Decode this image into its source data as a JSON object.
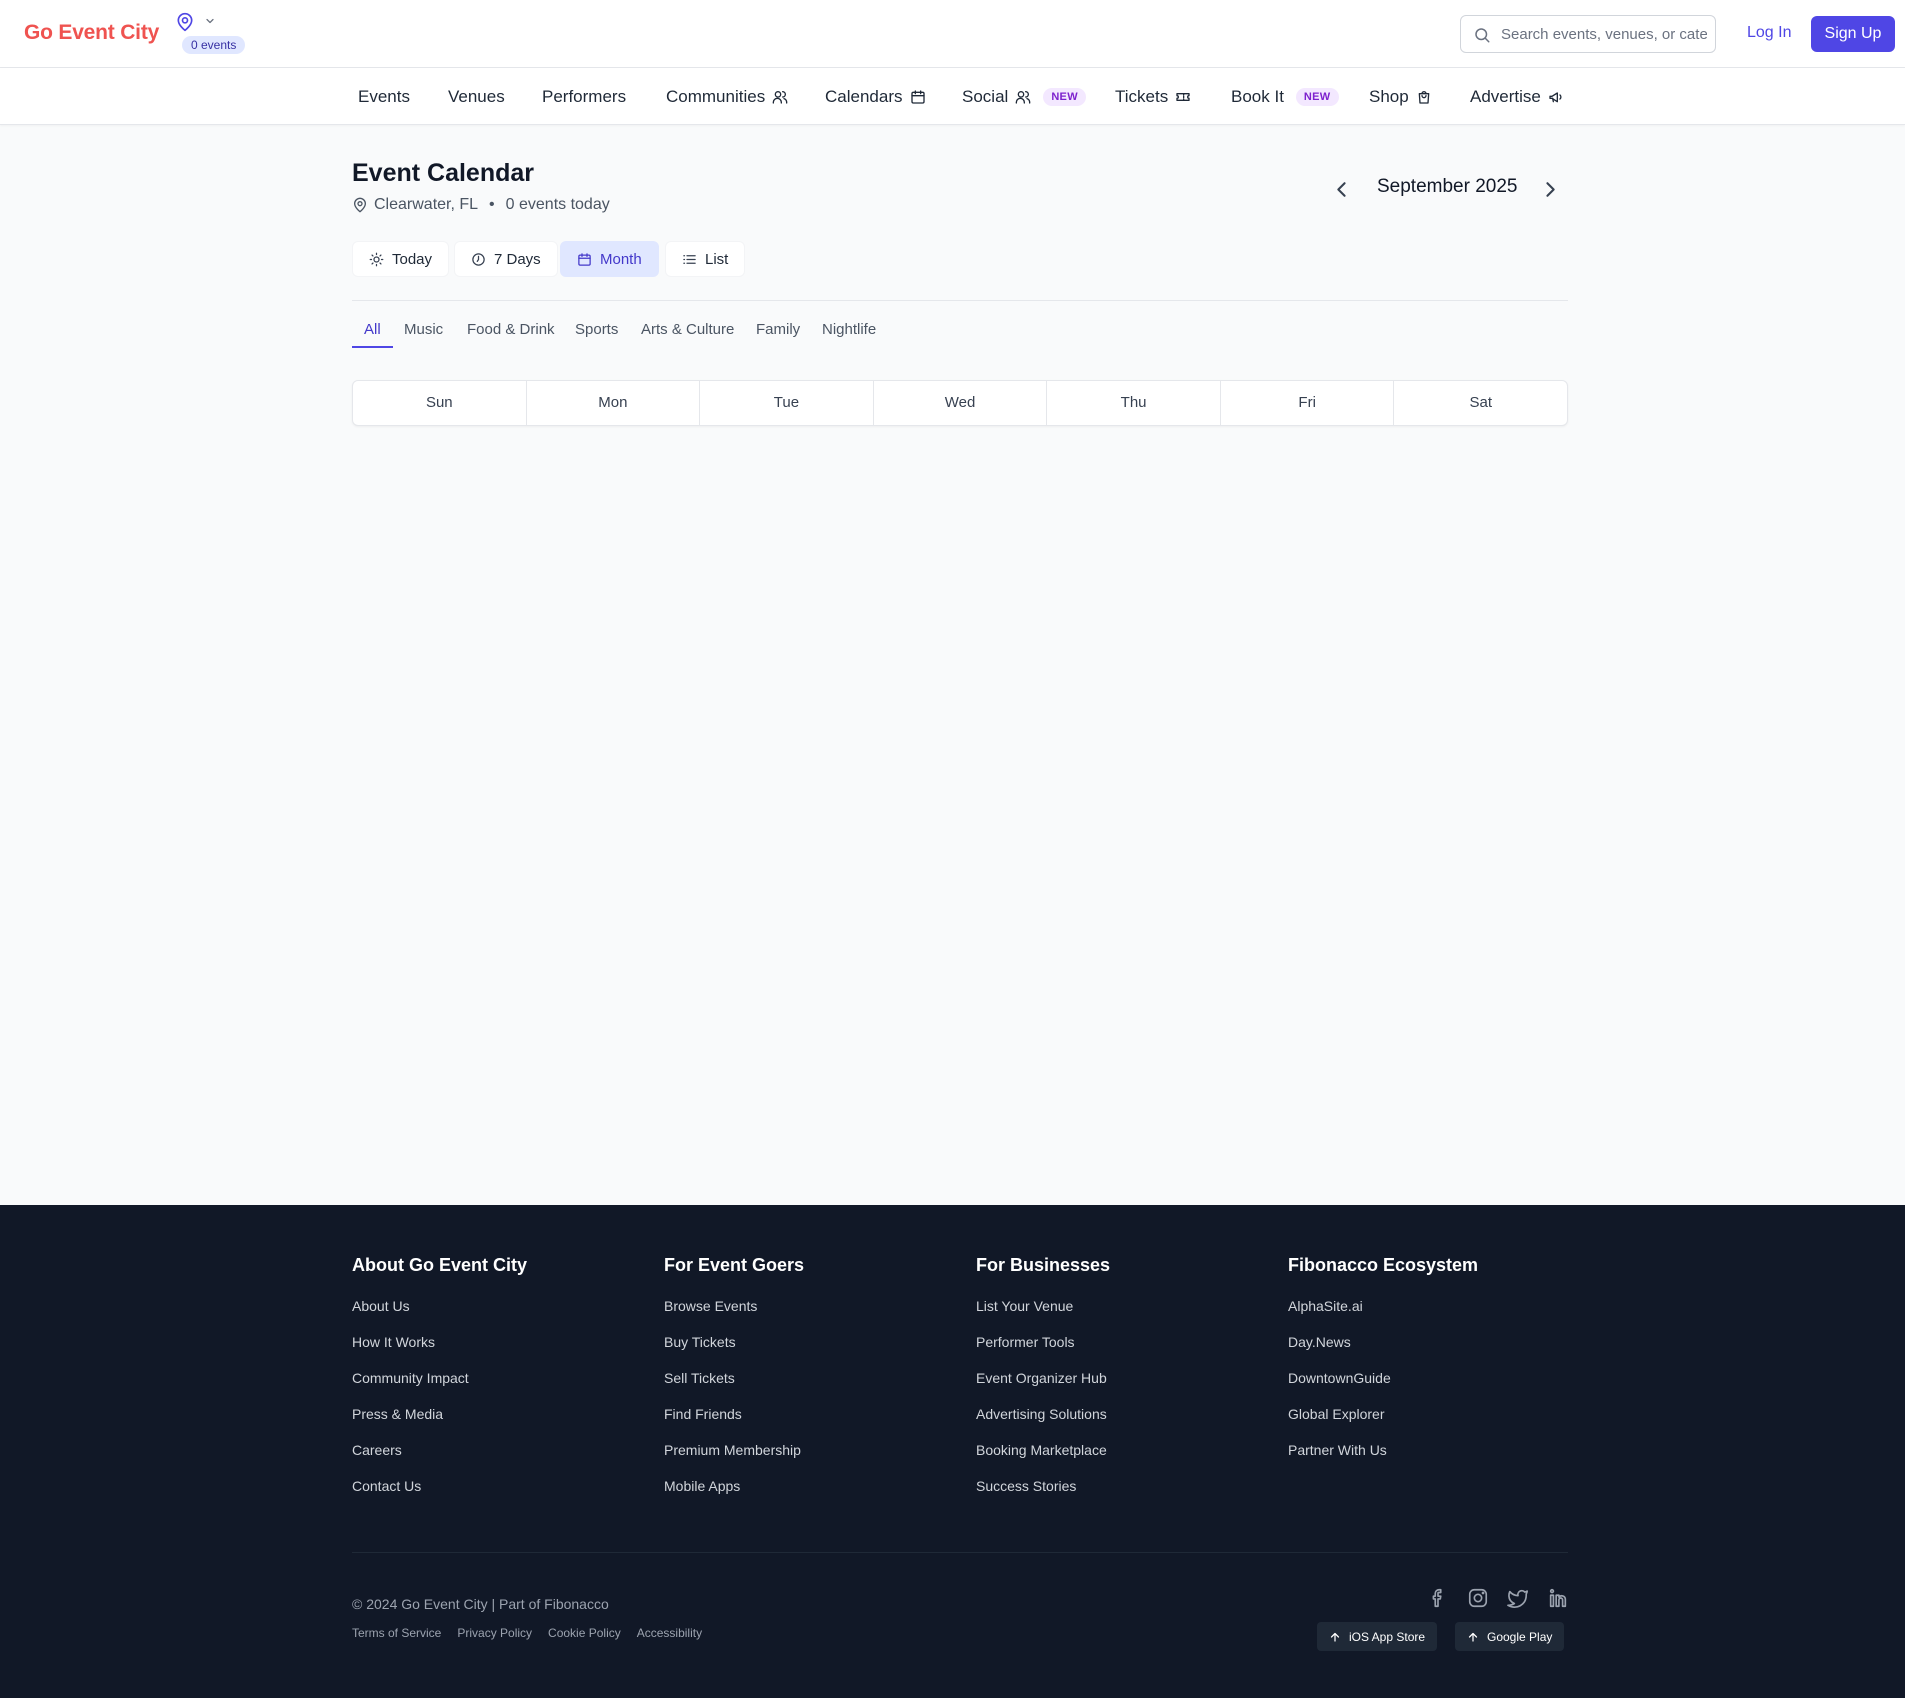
{
  "header": {
    "logo": "Go Event City",
    "events_badge": "0 events",
    "search_placeholder": "Search events, venues, or categories",
    "login": "Log In",
    "signup": "Sign Up"
  },
  "nav": {
    "items": [
      {
        "label": "Events",
        "icon": ""
      },
      {
        "label": "Venues",
        "icon": ""
      },
      {
        "label": "Performers",
        "icon": ""
      },
      {
        "label": "Communities",
        "icon": "users-icon"
      },
      {
        "label": "Calendars",
        "icon": "calendar-icon"
      },
      {
        "label": "Social",
        "icon": "users-icon",
        "badge": "NEW"
      },
      {
        "label": "Tickets",
        "icon": "ticket-icon"
      },
      {
        "label": "Book It",
        "icon": "",
        "badge": "NEW"
      },
      {
        "label": "Shop",
        "icon": "shopping-bag-icon"
      },
      {
        "label": "Advertise",
        "icon": "megaphone-icon"
      }
    ]
  },
  "calendar": {
    "title": "Event Calendar",
    "location": "Clearwater, FL",
    "separator": "•",
    "events_today": "0 events today",
    "month_label": "September 2025",
    "view_buttons": [
      {
        "label": "Today",
        "icon": "sun-icon"
      },
      {
        "label": "7 Days",
        "icon": "clock-icon"
      },
      {
        "label": "Month",
        "icon": "calendar-icon",
        "active": true
      },
      {
        "label": "List",
        "icon": "list-icon"
      }
    ],
    "categories": [
      "All",
      "Music",
      "Food & Drink",
      "Sports",
      "Arts & Culture",
      "Family",
      "Nightlife"
    ],
    "active_category": "All",
    "weekdays": [
      "Sun",
      "Mon",
      "Tue",
      "Wed",
      "Thu",
      "Fri",
      "Sat"
    ]
  },
  "footer": {
    "columns": [
      {
        "title": "About Go Event City",
        "links": [
          "About Us",
          "How It Works",
          "Community Impact",
          "Press & Media",
          "Careers",
          "Contact Us"
        ]
      },
      {
        "title": "For Event Goers",
        "links": [
          "Browse Events",
          "Buy Tickets",
          "Sell Tickets",
          "Find Friends",
          "Premium Membership",
          "Mobile Apps"
        ]
      },
      {
        "title": "For Businesses",
        "links": [
          "List Your Venue",
          "Performer Tools",
          "Event Organizer Hub",
          "Advertising Solutions",
          "Booking Marketplace",
          "Success Stories"
        ]
      },
      {
        "title": "Fibonacco Ecosystem",
        "links": [
          "AlphaSite.ai",
          "Day.News",
          "DowntownGuide",
          "Global Explorer",
          "Partner With Us"
        ]
      }
    ],
    "copyright": "© 2024 Go Event City | Part of Fibonacco",
    "legal": [
      "Terms of Service",
      "Privacy Policy",
      "Cookie Policy",
      "Accessibility"
    ],
    "social_icons": [
      "facebook-icon",
      "instagram-icon",
      "twitter-icon",
      "linkedin-icon"
    ],
    "stores": [
      "iOS App Store",
      "Google Play"
    ]
  },
  "colors": {
    "brand": "#ef5350",
    "accent": "#4f46e5",
    "footer_bg": "#111827"
  }
}
